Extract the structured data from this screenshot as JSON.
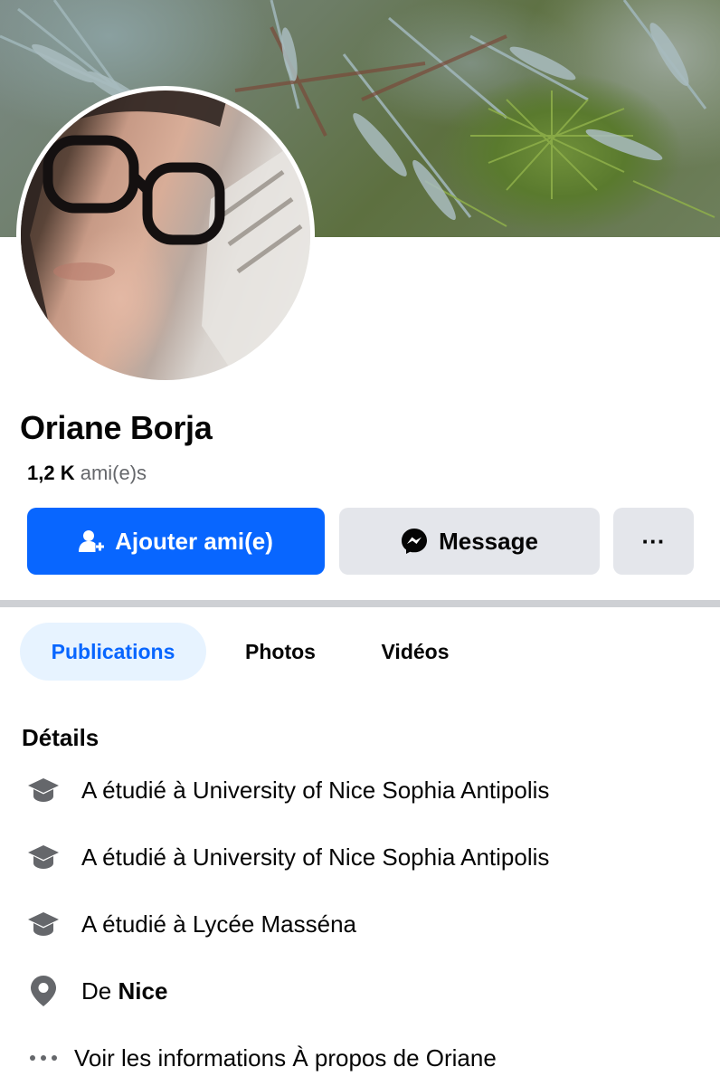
{
  "profile": {
    "name": "Oriane Borja",
    "friends_count": "1,2 K",
    "friends_label": "ami(e)s"
  },
  "actions": {
    "add_friend_label": "Ajouter ami(e)",
    "message_label": "Message",
    "more_label": "···"
  },
  "tabs": [
    {
      "label": "Publications",
      "active": true
    },
    {
      "label": "Photos",
      "active": false
    },
    {
      "label": "Vidéos",
      "active": false
    }
  ],
  "details": {
    "title": "Détails",
    "items": [
      {
        "icon": "graduation-cap-icon",
        "text": "A étudié à University of Nice Sophia Antipolis"
      },
      {
        "icon": "graduation-cap-icon",
        "text": "A étudié à University of Nice Sophia Antipolis"
      },
      {
        "icon": "graduation-cap-icon",
        "text": "A étudié à Lycée Masséna"
      },
      {
        "icon": "location-pin-icon",
        "prefix": "De",
        "place": "Nice"
      }
    ],
    "see_more": {
      "icon": "ellipsis-icon",
      "text": "Voir les informations À propos de Oriane"
    }
  },
  "colors": {
    "primary": "#0866ff",
    "secondary_button": "#e4e6eb",
    "active_tab_bg": "#e7f3ff",
    "muted_text": "#65676b",
    "icon_gray": "#65676b"
  }
}
